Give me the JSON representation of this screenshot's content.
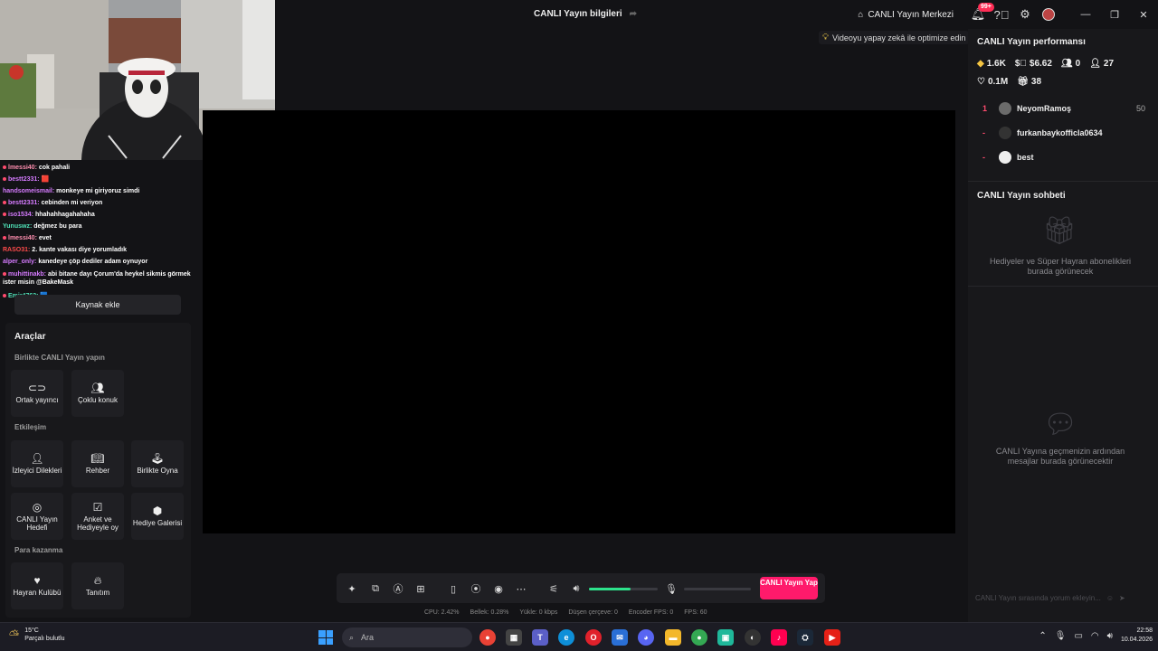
{
  "titlebar": {
    "title": "CANLI Yayın bilgileri",
    "live_center": "CANLI Yayın Merkezi",
    "notif_badge": "99+"
  },
  "ai_hint": "Videoyu yapay zekâ ile optimize edin",
  "chat_overlay": [
    {
      "user": "lmessi40:",
      "text": "cok pahali"
    },
    {
      "user": "bestt2331:",
      "text": ""
    },
    {
      "user": "handsomeismail:",
      "text": "monkeye mi giriyoruz simdi"
    },
    {
      "user": "bestt2331:",
      "text": "cebinden mi veriyon"
    },
    {
      "user": "iso1534:",
      "text": "hhahahhagahahaha"
    },
    {
      "user": "Yunuswz:",
      "text": "değmez bu para"
    },
    {
      "user": "lmessi40:",
      "text": "evet"
    },
    {
      "user": "RASO31:",
      "text": "2. kante vakası diye yorumladık"
    },
    {
      "user": "alper_only:",
      "text": "kanedeye çöp dediler adam oynuyor"
    },
    {
      "user": "muhittinakb:",
      "text": "abi bitane dayı Çorum'da heykel sikmis görmek ister misin @BakeMask"
    },
    {
      "user": "Emir4762:",
      "text": ""
    }
  ],
  "left": {
    "add_source": "Kaynak ekle",
    "tools_title": "Araçlar",
    "sections": {
      "together": "Birlikte CANLI Yayın yapın",
      "interaction": "Etkileşim",
      "monetize": "Para kazanma"
    },
    "tools": {
      "cohost": "Ortak yayıncı",
      "multi_guest": "Çoklu konuk",
      "viewer_wishes": "İzleyici Dilekleri",
      "guide": "Rehber",
      "play_together": "Birlikte Oyna",
      "live_goal": "CANLI Yayın Hedefi",
      "poll": "Anket ve Hediyeyle oy",
      "gift_gallery": "Hediye Galerisi",
      "fan_club": "Hayran Kulübü",
      "promote": "Tanıtım"
    }
  },
  "right": {
    "perf_title": "CANLI Yayın performansı",
    "stats": {
      "diamonds": "1.6K",
      "earnings": "$6.62",
      "viewers": "0",
      "followers": "27",
      "likes": "0.1M",
      "gifts": "38"
    },
    "leaderboard": [
      {
        "rank": "1",
        "name": "NeyomRamoş",
        "score": "50"
      },
      {
        "rank": "-",
        "name": "furkanbaykofficla0634",
        "score": ""
      },
      {
        "rank": "-",
        "name": "best",
        "score": ""
      }
    ],
    "chat_title": "CANLI Yayın sohbeti",
    "gifts_empty": "Hediyeler ve Süper Hayran abonelikleri burada görünecek",
    "chat_empty": "CANLI Yayına geçmenizin ardından mesajlar burada görünecektir",
    "chat_placeholder": "CANLI Yayın sırasında yorum ekleyin..."
  },
  "controls": {
    "go_live": "CANLI Yayın Yap",
    "volume_level": 0.6
  },
  "statusbar": {
    "cpu": "CPU:  2.42%",
    "memory": "Bellek:  0.28%",
    "upload": "Yükle:  0 kbps",
    "dropped": "Düşen çerçeve:  0",
    "encoder_fps": "Encoder FPS:  0",
    "fps": "FPS:  60"
  },
  "taskbar": {
    "temp": "15°C",
    "weather": "Parçalı bulutlu",
    "search": "Ara",
    "time": "22:58",
    "date": "10.04.2026"
  }
}
